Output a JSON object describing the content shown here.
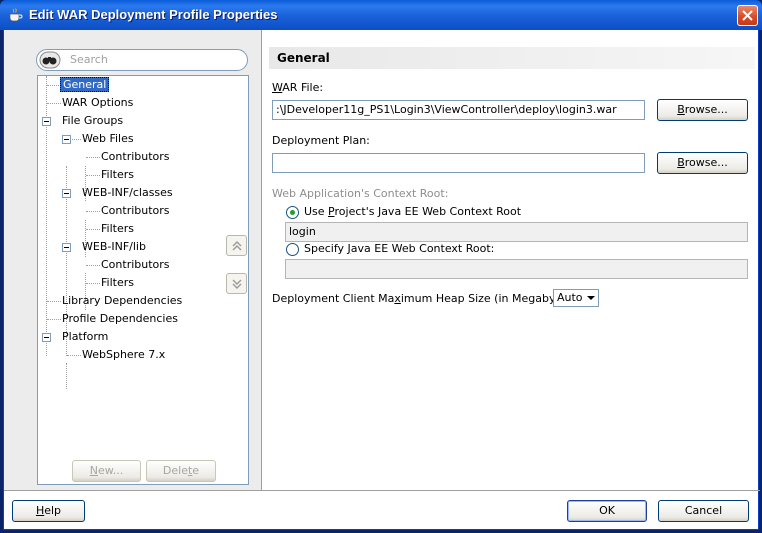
{
  "window": {
    "title": "Edit WAR Deployment Profile Properties"
  },
  "search": {
    "placeholder": "Search"
  },
  "tree": {
    "items": [
      {
        "label": "General"
      },
      {
        "label": "WAR Options"
      },
      {
        "label": "File Groups"
      },
      {
        "label": "Web Files"
      },
      {
        "label": "Contributors"
      },
      {
        "label": "Filters"
      },
      {
        "label": "WEB-INF/classes"
      },
      {
        "label": "Contributors"
      },
      {
        "label": "Filters"
      },
      {
        "label": "WEB-INF/lib"
      },
      {
        "label": "Contributors"
      },
      {
        "label": "Filters"
      },
      {
        "label": "Library Dependencies"
      },
      {
        "label": "Profile Dependencies"
      },
      {
        "label": "Platform"
      },
      {
        "label": "WebSphere 7.x"
      }
    ],
    "new_pre": "",
    "new_u": "N",
    "new_post": "ew...",
    "delete_pre": "Dele",
    "delete_u": "t",
    "delete_post": "e"
  },
  "general": {
    "header": "General",
    "war_file_u": "W",
    "war_file_rest": "AR File:",
    "war_file_value": ":\\JDeveloper11g_PS1\\Login3\\ViewController\\deploy\\login3.war",
    "browse_u": "B",
    "browse_rest": "rowse...",
    "deployment_plan_label": "Deployment Plan:",
    "deployment_plan_value": "",
    "context_root_label": "Web Application's Context Root:",
    "use_project_pre": "Use ",
    "use_project_u": "P",
    "use_project_post": "roject's Java EE Web Context Root",
    "use_project_value": "login",
    "specify_pre": "Specify ",
    "specify_u": "J",
    "specify_post": "ava EE Web Context Root:",
    "specify_value": "",
    "heap_pre": "Deployment Client Ma",
    "heap_u": "x",
    "heap_post": "imum Heap Size (in Megabytes):",
    "heap_value": "Auto"
  },
  "footer": {
    "help_u": "H",
    "help_rest": "elp",
    "ok_label": "OK",
    "cancel_label": "Cancel"
  }
}
